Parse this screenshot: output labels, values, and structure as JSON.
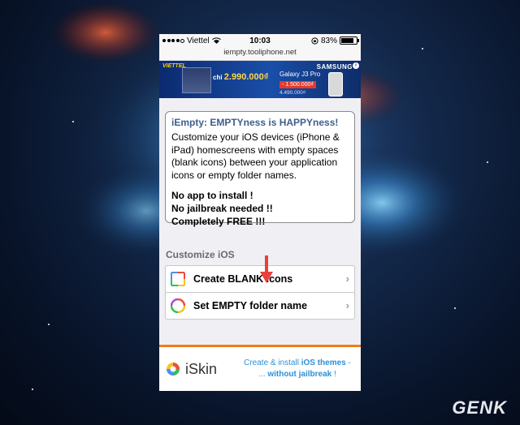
{
  "status_bar": {
    "carrier": "Viettel",
    "time": "10:03",
    "battery": "83%"
  },
  "url_bar": {
    "url": "iempty.tooliphone.net"
  },
  "ad_banner": {
    "brand_left": "VIETTEL",
    "price_prefix": "chỉ",
    "price": "2.990.000₫",
    "model": "Galaxy J3 Pro",
    "discount": "- 1.500.000₫",
    "old_price": "4.490.000₫",
    "brand_right": "SAMSUNG",
    "info_icon": "i"
  },
  "intro": {
    "heading": "iEmpty: EMPTYness is HAPPYness!",
    "body": "Customize your iOS devices (iPhone & iPad) homescreens with empty spaces (blank icons) between your application icons or empty folder names.",
    "feature_1": "No app to install !",
    "feature_2": "No jailbreak needed !!",
    "feature_3": "Completely FREE !!!"
  },
  "customize": {
    "title": "Customize iOS",
    "items": [
      {
        "label": "Create BLANK icons",
        "icon": "blank-square-icon"
      },
      {
        "label": "Set EMPTY folder name",
        "icon": "rainbow-circle-icon"
      }
    ]
  },
  "promo": {
    "logo_text": "iSkin",
    "line1_prefix": "Create & install ",
    "line1_bold": "iOS themes",
    "line1_suffix": " -",
    "line2_prefix": "... ",
    "line2_bold": "without jailbreak",
    "line2_suffix": " !"
  },
  "watermark": {
    "text_main": "GEN",
    "text_end": "K"
  },
  "colors": {
    "heading_blue": "#3e5d8c",
    "promo_orange": "#f07c14",
    "link_blue": "#2d8fd8",
    "arrow_red": "#e8413a"
  }
}
